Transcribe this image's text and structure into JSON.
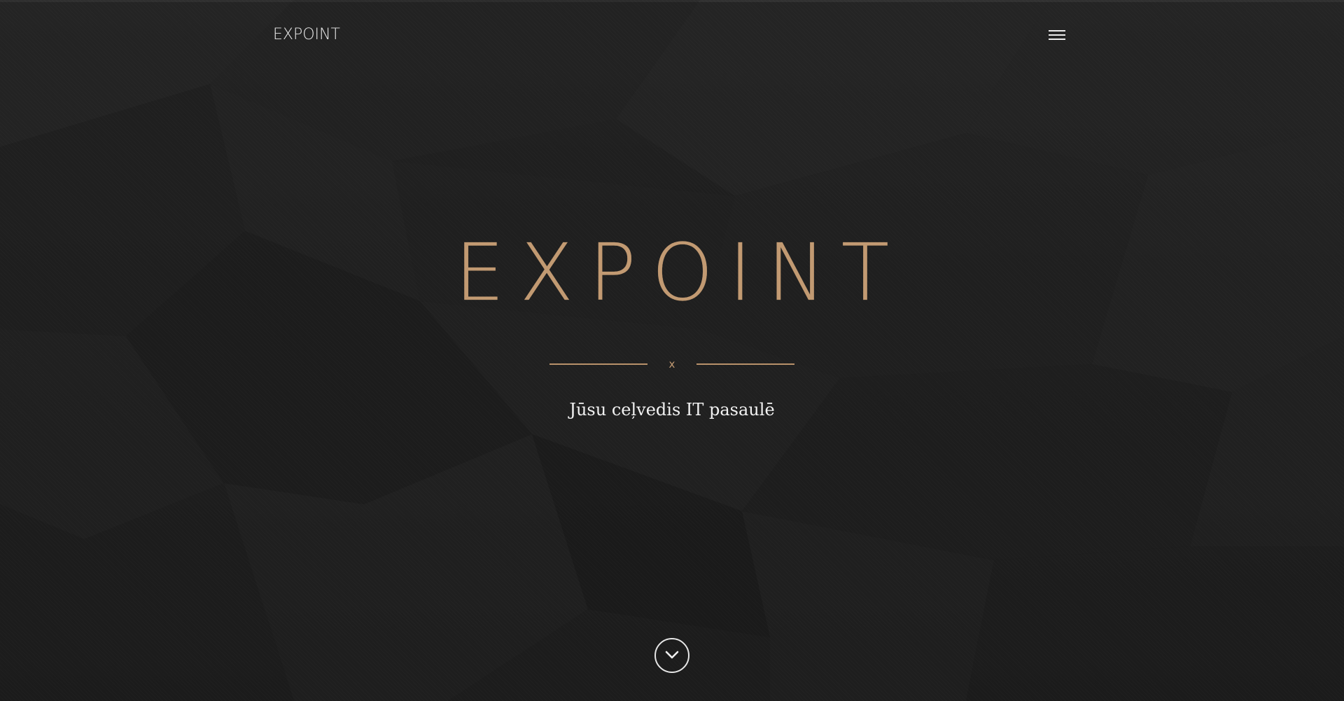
{
  "header": {
    "logo_text": "EXPOINT",
    "menu_icon": "hamburger-menu-icon"
  },
  "hero": {
    "title": "EXPOINT",
    "divider_mark": "x",
    "tagline": "Jūsu ceļvedis IT pasaulē",
    "scroll_icon": "chevron-down-icon"
  },
  "colors": {
    "background": "#1c1c1c",
    "accent": "#c29a72",
    "text": "#f2f2f2"
  }
}
